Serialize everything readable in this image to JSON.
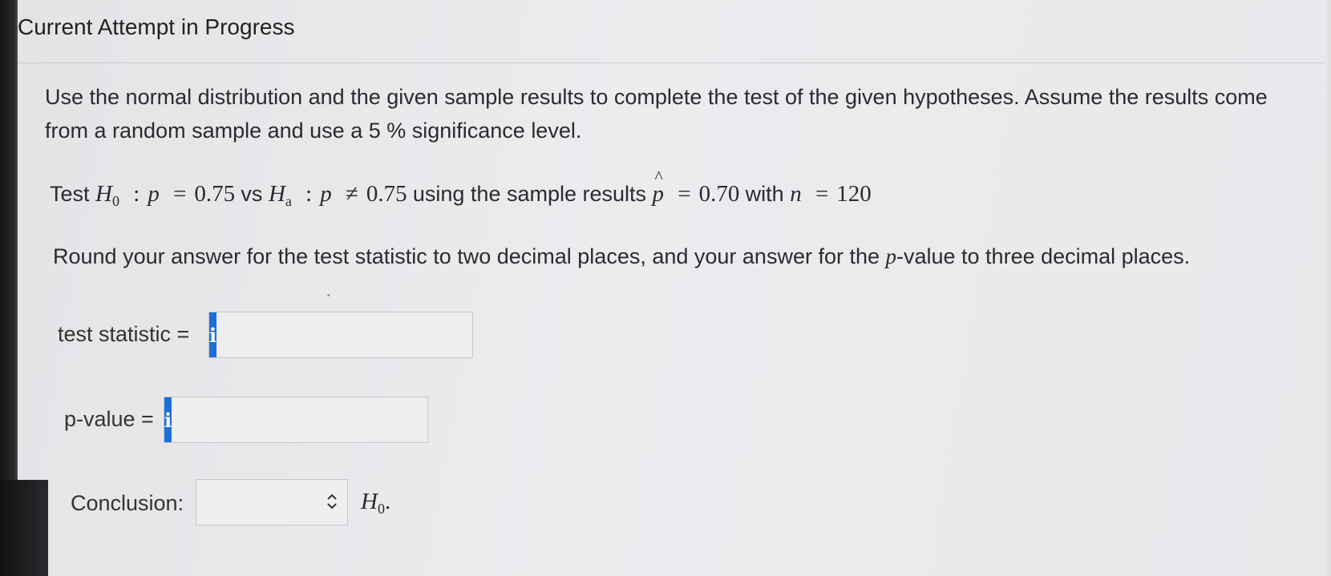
{
  "header": {
    "title": "Current Attempt in Progress"
  },
  "question": {
    "prompt": "Use the normal distribution and the given sample results to complete the test of the given hypotheses. Assume the results come from a random sample and use a 5 %  significance level.",
    "hypothesis": {
      "test_word": "Test",
      "h0_symbol": "H",
      "h0_sub": "0",
      "colon": ":",
      "p": "p",
      "equals": "=",
      "p0": "0.75",
      "vs_word": "vs",
      "ha_symbol": "H",
      "ha_sub": "a",
      "not_equal": "≠",
      "using_text": "using the sample results",
      "phat_letter": "p",
      "phat_hat": "^",
      "phat_value": "0.70",
      "with_word": "with",
      "n_letter": "n",
      "n_value": "120"
    },
    "rounding": {
      "before_p": "Round your answer for the test statistic to two decimal places, and your answer for the ",
      "p_letter": "p",
      "after_p": "-value to three decimal places."
    }
  },
  "answers": {
    "test_statistic": {
      "label": "test statistic =",
      "info": "i",
      "value": ""
    },
    "p_value": {
      "label": "p-value =",
      "info": "i",
      "value": ""
    },
    "conclusion": {
      "label": "Conclusion:",
      "selected": "",
      "suffix_symbol": "H",
      "suffix_sub": "0",
      "suffix_punct": "."
    }
  },
  "colors": {
    "info_button": "#1c6fd8",
    "page_background": "#ebeaed"
  },
  "stray_mark": "•"
}
